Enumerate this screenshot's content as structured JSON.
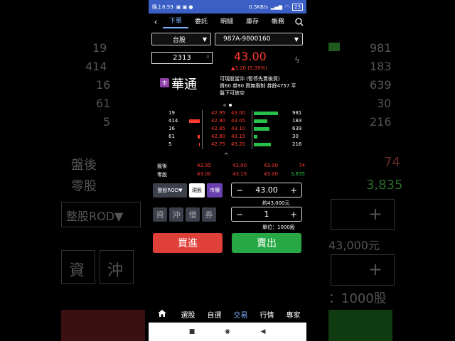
{
  "status": {
    "time": "晚上8:59",
    "speed": "0.5KB/s",
    "battery": "23"
  },
  "nav": {
    "tabs": [
      "下單",
      "委託",
      "明細",
      "庫存",
      "帳務"
    ],
    "active": 0
  },
  "selectors": {
    "market": "台股",
    "account": "987A-9800160"
  },
  "stock": {
    "code": "2313",
    "price": "43.00",
    "change": "▲3.20 (5.39%)",
    "market_badge": "市",
    "name": "華通",
    "info_line1": "可現股當沖 (暫停先賣後買)",
    "info_line2": "資60 券90 資無限制 券餘4757 平",
    "info_line3": "盤下可放空"
  },
  "book": {
    "rows": [
      {
        "bid_qty": "19",
        "bid": "42.95",
        "ask": "43.00",
        "ask_qty": "981"
      },
      {
        "bid_qty": "414",
        "bid": "42.90",
        "ask": "43.05",
        "ask_qty": "183"
      },
      {
        "bid_qty": "16",
        "bid": "42.85",
        "ask": "43.10",
        "ask_qty": "639"
      },
      {
        "bid_qty": "61",
        "bid": "42.80",
        "ask": "43.15",
        "ask_qty": "30"
      },
      {
        "bid_qty": "5",
        "bid": "42.75",
        "ask": "43.20",
        "ask_qty": "216"
      }
    ],
    "bid_bar_fill": [
      0.0,
      0.55,
      0.0,
      0.1,
      0.05
    ],
    "ask_bar_fill": [
      1.0,
      0.55,
      0.65,
      0.15,
      0.7
    ]
  },
  "summary": [
    {
      "label": "盤後",
      "v1": "42.95",
      "v2": "43.00",
      "v3": "43.00",
      "v4": "74"
    },
    {
      "label": "零股",
      "v1": "43.00",
      "v2": "43.15",
      "v3": "43.00",
      "v4": "3,835"
    }
  ],
  "order": {
    "type": "整股ROD▼",
    "cash": "現股",
    "market_price": "市價",
    "price": "43.00",
    "approx": "約43,000元",
    "qty": "1",
    "unit": "單位：1000股",
    "minus": "−",
    "plus": "+",
    "credit_buttons": [
      "資",
      "沖",
      "借",
      "券"
    ]
  },
  "actions": {
    "buy": "買進",
    "sell": "賣出"
  },
  "bottom_nav": [
    "選股",
    "自選",
    "交易",
    "行情",
    "專家"
  ],
  "colors": {
    "up": "#ff3b30",
    "down": "#27c14a",
    "accent": "#7fb0ff",
    "status_bar": "#3b5fc4",
    "buy": "#e0403a",
    "sell": "#27a844"
  }
}
